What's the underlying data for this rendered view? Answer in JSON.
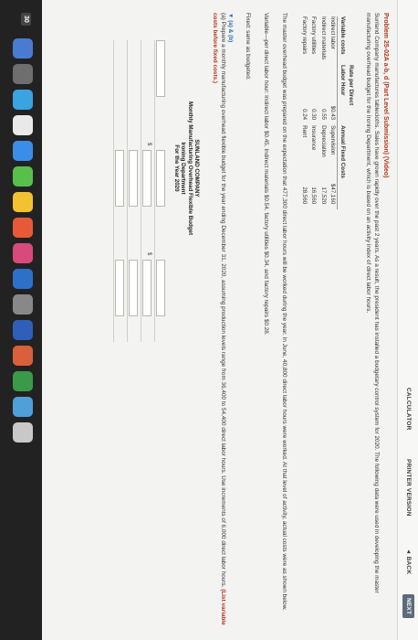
{
  "toolbar": {
    "calculator": "CALCULATOR",
    "printer": "PRINTER VERSION",
    "back": "◄ BACK",
    "next": "NEXT"
  },
  "problem": {
    "title": "Problem 25-02A a-b, d (Part Level Submission) (Video)",
    "intro": "Sunland Company manufactures tablecloths. Sales have grown rapidly over the past 2 years. As a result, the president has installed a budgetary control system for 2020. The following data were used in developing the master manufacturing overhead budget for the Ironing Department, which is based on an activity index of direct labor hours.",
    "table": {
      "headers": [
        "Variable costs",
        "Rate per Direct Labor Hour",
        "Annual Fixed Costs",
        ""
      ],
      "rows": [
        [
          "Indirect labor",
          "$0.43",
          "Supervision",
          "$47,160"
        ],
        [
          "Indirect materials",
          "0.55",
          "Depreciation",
          "17,520"
        ],
        [
          "Factory utilities",
          "0.30",
          "Insurance",
          "16,560"
        ],
        [
          "Factory repairs",
          "0.24",
          "Rent",
          "28,560"
        ]
      ]
    },
    "para2": "The master overhead budget was prepared on the expectation that 477,300 direct labor hours will be worked during the year. In June, 40,800 direct labor hours were worked. At that level of activity, actual costs were as shown below.",
    "para3": "Variable—per direct labor hour: Indirect labor $0.45, Indirect materials $0.54, factory utilities $0.34, and factory repairs $0.28.",
    "para4": "Fixed: same as budgeted.",
    "part_label": "▼ (a) & (b)",
    "part_text_a": "(a) Prepare a monthly manufacturing overhead flexible budget for the year ending December 31, 2020, assuming production levels range from 36,400 to 54,400 direct labor hours. Use increments of 6,000 direct labor hours.",
    "part_text_b": "(List variable costs before fixed costs.)",
    "budget": {
      "company": "SUNLAND COMPANY",
      "name": "Monthly Manufacturing Overhead Flexible Budget",
      "dept": "Ironing Department",
      "period": "For the Year 2020"
    },
    "dollar": "$"
  },
  "dock": {
    "badge": "30"
  }
}
